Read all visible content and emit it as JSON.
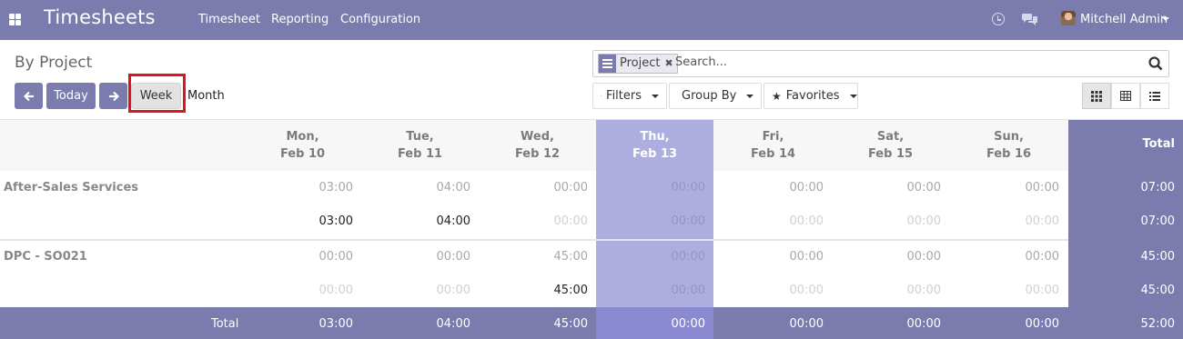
{
  "navbar": {
    "app_title": "Timesheets",
    "menu": [
      "Timesheet",
      "Reporting",
      "Configuration"
    ],
    "user": "Mitchell Admin"
  },
  "control_panel": {
    "title": "By Project",
    "today_label": "Today",
    "week_label": "Week",
    "month_label": "Month",
    "search": {
      "facet": "Project",
      "placeholder": "Search..."
    },
    "filters_label": "Filters",
    "group_by_label": "Group By",
    "favorites_label": "Favorites"
  },
  "grid": {
    "days": [
      {
        "weekday": "Mon,",
        "date": "Feb 10"
      },
      {
        "weekday": "Tue,",
        "date": "Feb 11"
      },
      {
        "weekday": "Wed,",
        "date": "Feb 12"
      },
      {
        "weekday": "Thu,",
        "date": "Feb 13"
      },
      {
        "weekday": "Fri,",
        "date": "Feb 14"
      },
      {
        "weekday": "Sat,",
        "date": "Feb 15"
      },
      {
        "weekday": "Sun,",
        "date": "Feb 16"
      }
    ],
    "total_header": "Total",
    "rows": [
      {
        "label": "After-Sales Services",
        "values": [
          "03:00",
          "04:00",
          "00:00",
          "00:00",
          "00:00",
          "00:00",
          "00:00"
        ],
        "total": "07:00"
      },
      {
        "label": "",
        "values": [
          "03:00",
          "04:00",
          "00:00",
          "00:00",
          "00:00",
          "00:00",
          "00:00"
        ],
        "total": "07:00"
      },
      {
        "label": "DPC - SO021",
        "values": [
          "00:00",
          "00:00",
          "45:00",
          "00:00",
          "00:00",
          "00:00",
          "00:00"
        ],
        "total": "45:00"
      },
      {
        "label": "",
        "values": [
          "00:00",
          "00:00",
          "45:00",
          "00:00",
          "00:00",
          "00:00",
          "00:00"
        ],
        "total": "45:00"
      }
    ],
    "footer": {
      "label": "Total",
      "values": [
        "03:00",
        "04:00",
        "45:00",
        "00:00",
        "00:00",
        "00:00",
        "00:00"
      ],
      "total": "52:00"
    }
  },
  "colors": {
    "brand": "#7c7bad",
    "today_column": "#aeaddf",
    "highlight": "#e0141e"
  }
}
